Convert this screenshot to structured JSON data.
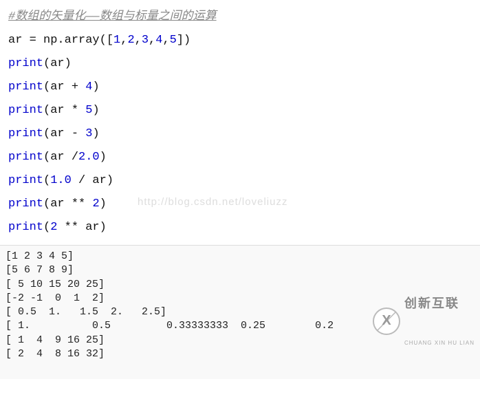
{
  "code": {
    "comment": "#数组的矢量化——数组与标量之间的运算",
    "line2_pre": "ar = np.array([",
    "line2_nums": [
      "1",
      "2",
      "3",
      "4",
      "5"
    ],
    "line2_post": "])",
    "print": "print",
    "line3": "(ar)",
    "line4_a": "(ar + ",
    "line4_n": "4",
    "line4_b": ")",
    "line5_a": "(ar * ",
    "line5_n": "5",
    "line5_b": ")",
    "line6_a": "(ar - ",
    "line6_n": "3",
    "line6_b": ")",
    "line7_a": "(ar /",
    "line7_n": "2.0",
    "line7_b": ")",
    "line8_a": "(",
    "line8_n": "1.0",
    "line8_b": " / ar)",
    "line9_a": "(ar ** ",
    "line9_n": "2",
    "line9_b": ")",
    "line10_a": "(",
    "line10_n": "2",
    "line10_b": " ** ar)"
  },
  "watermark": "http://blog.csdn.net/loveliuzz",
  "output": "[1 2 3 4 5]\n[5 6 7 8 9]\n[ 5 10 15 20 25]\n[-2 -1  0  1  2]\n[ 0.5  1.   1.5  2.   2.5]\n[ 1.          0.5         0.33333333  0.25        0.2       ]\n[ 1  4  9 16 25]\n[ 2  4  8 16 32]",
  "logo": {
    "cn": "创新互联",
    "en": "CHUANG XIN HU LIAN"
  }
}
